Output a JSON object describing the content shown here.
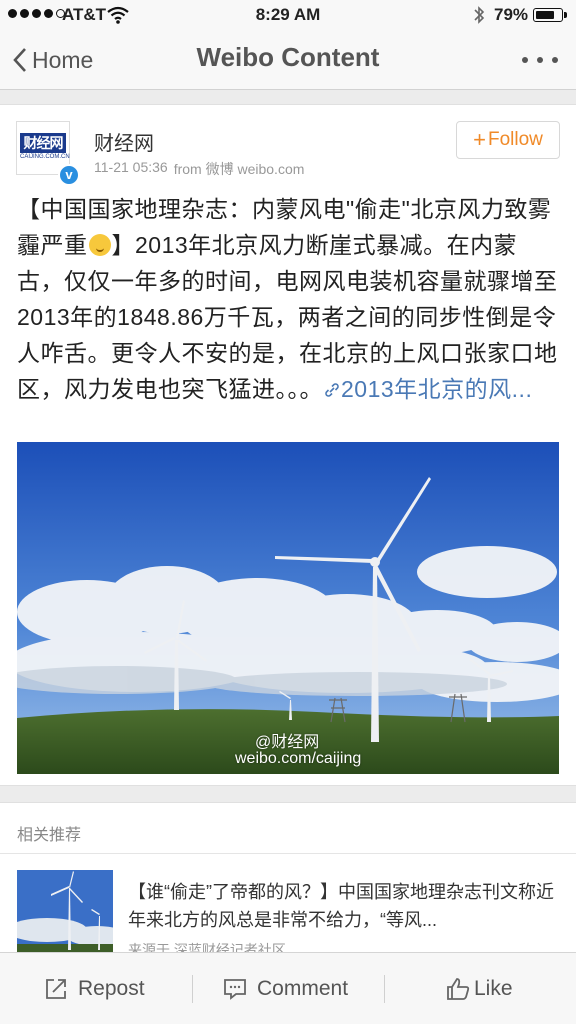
{
  "status_bar": {
    "carrier": "AT&T",
    "time": "8:29 AM",
    "battery_percent": "79%",
    "battery_level": 0.79
  },
  "nav": {
    "back_label": "Home",
    "title": "Weibo Content"
  },
  "post": {
    "author": "财经网",
    "avatar_logo_text": "财经网",
    "avatar_logo_sub": "CAIJING.COM.CN",
    "timestamp": "11-21 05:36",
    "source": "from 微博 weibo.com",
    "follow_label": "Follow",
    "text_part1": "【中国国家地理杂志：内蒙风电\"偷走\"北京风力致雾霾严重",
    "text_part2": "】2013年北京风力断崖式暴减。在内蒙古，仅仅一年多的时间，电网风电装机容量就骤增至2013年的1848.86万千瓦，两者之间的同步性倒是令人咋舌。更令人不安的是，在北京的上风口张家口地区，风力发电也突飞猛进。。。",
    "link_text": "2013年北京的风...",
    "image_watermark_name": "@财经网",
    "image_watermark_url": "weibo.com/caijing"
  },
  "related": {
    "header": "相关推荐",
    "item_text": "【谁“偷走”了帝都的风？】中国国家地理杂志刊文称近年来北方的风总是非常不给力，“等风...",
    "item_source": "来源于 深蓝财经记者社区"
  },
  "toolbar": {
    "repost_label": "Repost",
    "comment_label": "Comment",
    "like_label": "Like"
  },
  "colors": {
    "follow": "#f08a28",
    "link": "#4a79b5",
    "verified": "#2a8fe0"
  }
}
